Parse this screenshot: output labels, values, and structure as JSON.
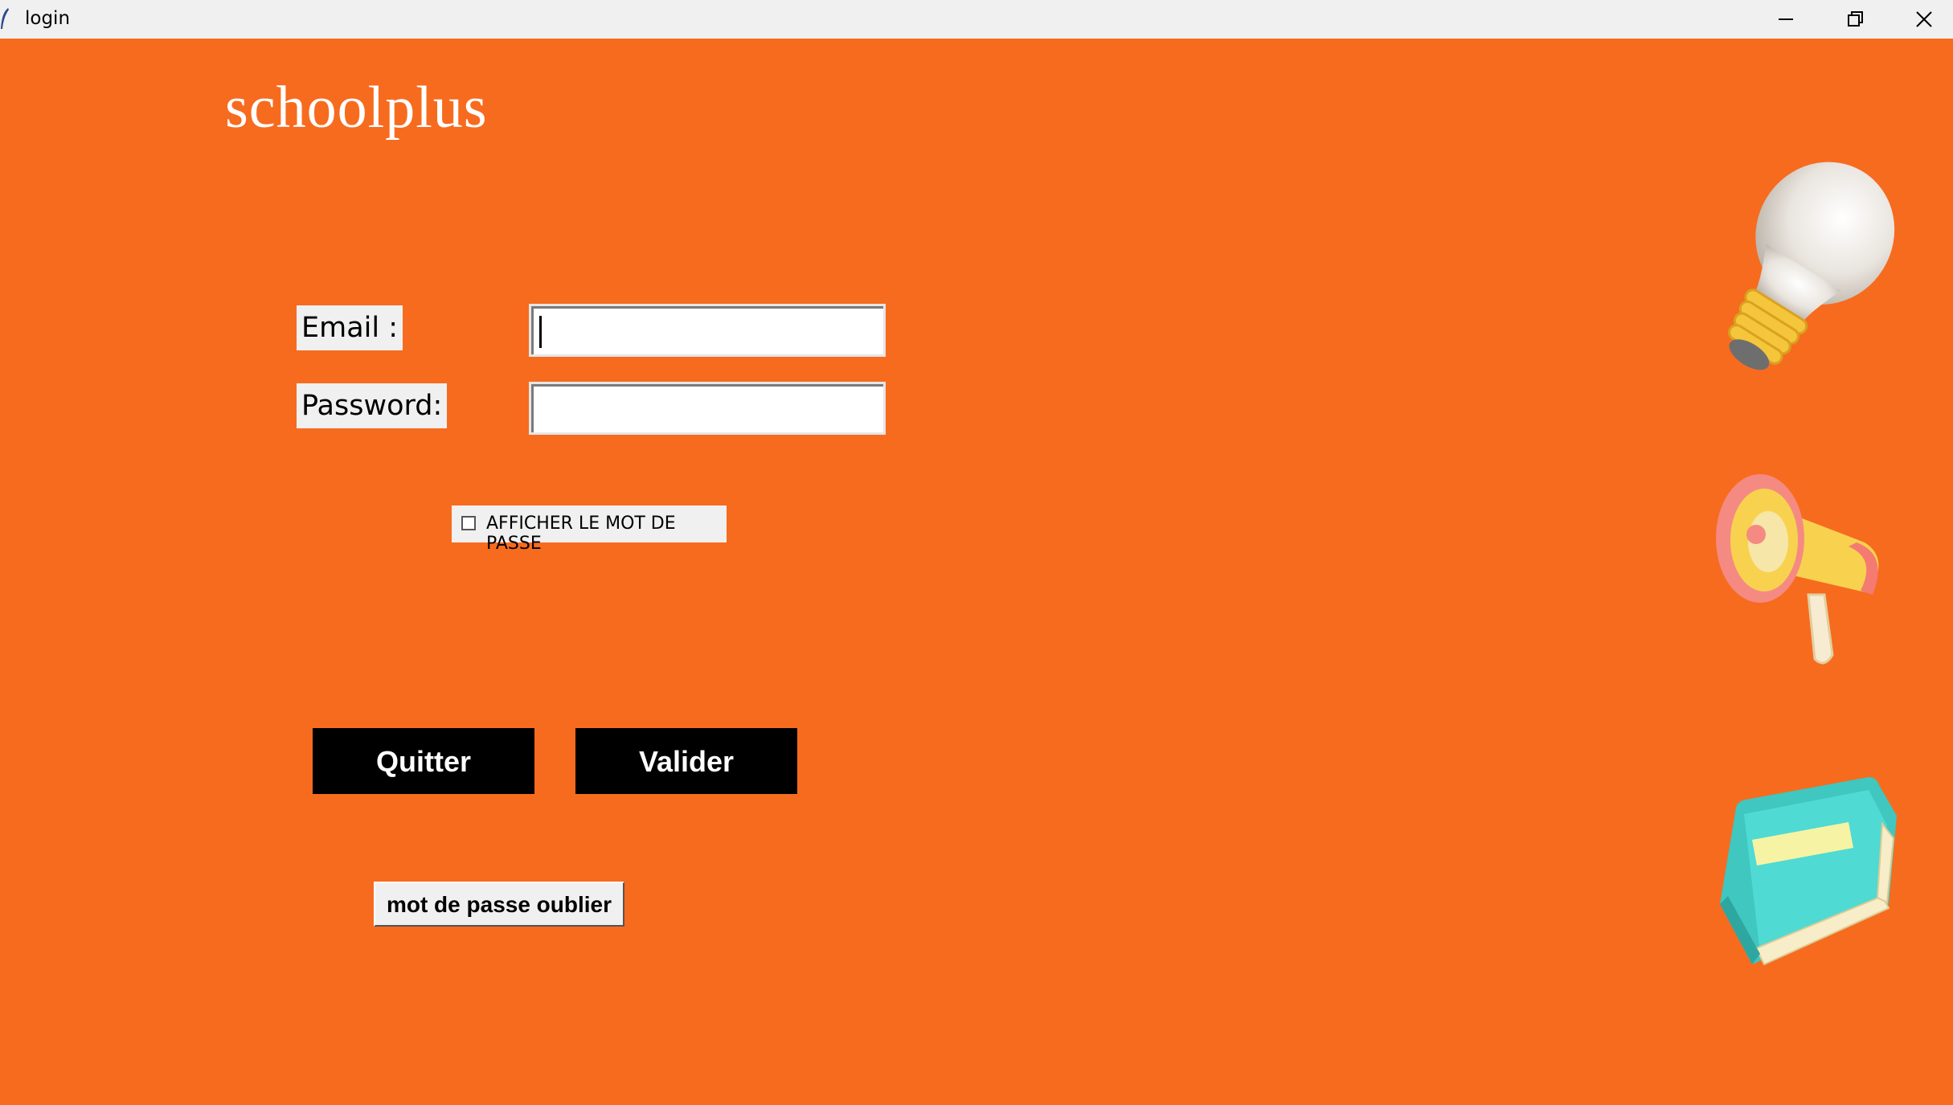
{
  "window": {
    "title": "login",
    "icon": "feather-icon",
    "controls": [
      "minimize-icon",
      "maximize-icon",
      "close-icon"
    ]
  },
  "brand": "schoolplus",
  "form": {
    "email_label": "Email :",
    "email_value": "",
    "password_label": "Password:",
    "password_value": "",
    "show_password_label": "AFFICHER LE MOT DE PASSE",
    "show_password_checked": false
  },
  "buttons": {
    "quit": "Quitter",
    "validate": "Valider",
    "forgot": "mot de passe oublier"
  },
  "illustrations": [
    "lightbulb-icon",
    "megaphone-icon",
    "book-icon"
  ],
  "colors": {
    "background": "#f76b1f",
    "button_bg": "#000000",
    "button_text": "#ffffff",
    "label_bg": "#f0f0f0"
  }
}
